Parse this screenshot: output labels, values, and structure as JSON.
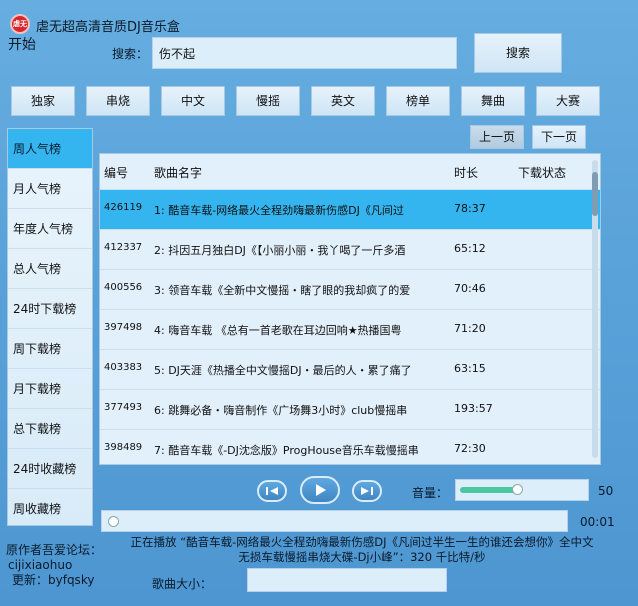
{
  "app": {
    "icon_text": "虐无",
    "title": "虐无超高清音质DJ音乐盒",
    "start_label": "开始"
  },
  "search": {
    "label": "搜索：",
    "value": "伤不起",
    "button_label": "搜索"
  },
  "categories": [
    "独家",
    "串烧",
    "中文",
    "慢摇",
    "英文",
    "榜单",
    "舞曲",
    "大赛"
  ],
  "sidebar": {
    "items": [
      "周人气榜",
      "月人气榜",
      "年度人气榜",
      "总人气榜",
      "24时下载榜",
      "周下载榜",
      "月下载榜",
      "总下载榜",
      "24时收藏榜",
      "周收藏榜"
    ],
    "active_index": 0
  },
  "pager": {
    "prev_label": "上一页",
    "next_label": "下一页"
  },
  "table": {
    "headers": {
      "id": "编号",
      "name": "歌曲名字",
      "duration": "时长",
      "status": "下载状态"
    },
    "rows": [
      {
        "id": "426119",
        "name": "1: 酷音车载-网络最火全程劲嗨最新伤感DJ《凡间过",
        "duration": "78:37",
        "selected": true
      },
      {
        "id": "412337",
        "name": "2: 抖因五月独白DJ《【小丽小丽・我丫喝了一斤多酒",
        "duration": "65:12"
      },
      {
        "id": "400556",
        "name": "3: 领音车载《全新中文慢摇・瞎了眼的我却疯了的爱",
        "duration": "70:46"
      },
      {
        "id": "397498",
        "name": "4: 嗨音车载 《总有一首老歌在耳边回响★热播国粤",
        "duration": "71:20"
      },
      {
        "id": "403383",
        "name": "5: DJ天涯《热播全中文慢摇DJ・最后的人・累了痛了",
        "duration": "63:15"
      },
      {
        "id": "377493",
        "name": "6: 跳舞必备・嗨音制作《广场舞3小时》club慢摇串",
        "duration": "193:57"
      },
      {
        "id": "398489",
        "name": "7: 酷音车载《-DJ沈念版》ProgHouse音乐车载慢摇串",
        "duration": "72:30"
      }
    ]
  },
  "player": {
    "volume_label": "音量：",
    "volume_value": "50",
    "volume_fraction": 0.5,
    "time": "00:01",
    "progress_fraction": 0.0,
    "now_playing_line1": "正在播放 “酷音车载-网络最火全程劲嗨最新伤感DJ《凡间过半生一生的谁还会想你》全中文",
    "now_playing_line2": "无损车载慢摇串烧大碟-Dj小峰”：320 千比特/秒"
  },
  "footer": {
    "author_line1": "原作者吾爱论坛：",
    "author_line2": "cijixiaohuo",
    "update_line": "更新：byfqsky",
    "size_label": "歌曲大小："
  }
}
